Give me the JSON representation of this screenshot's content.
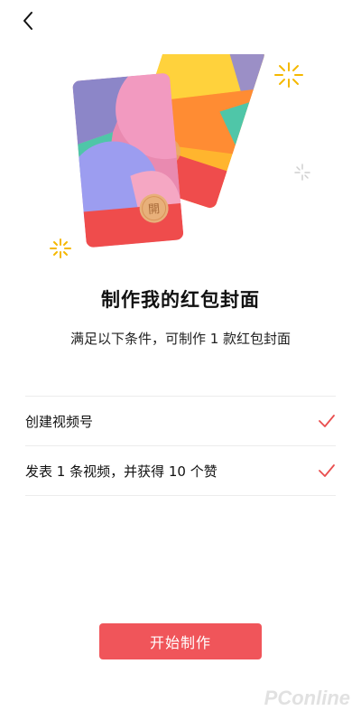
{
  "header": {
    "back_icon": "chevron-left-icon"
  },
  "hero": {
    "card_seal_char": "開",
    "colors": {
      "card_bottom": "#ef4c4c",
      "pink": "#eb8fb4",
      "purple": "#8c86c8",
      "teal": "#4fc6a8",
      "yellow": "#ffcf33",
      "orange": "#ff8a33",
      "sparkle": "#f5b800"
    }
  },
  "title": "制作我的红包封面",
  "subtitle": "满足以下条件，可制作 1 款红包封面",
  "requirements": [
    {
      "label": "创建视频号",
      "status": "done",
      "icon": "checkmark-icon"
    },
    {
      "label": "发表 1 条视频，并获得 10 个赞",
      "status": "done",
      "icon": "checkmark-icon"
    }
  ],
  "start_button": {
    "label": "开始制作",
    "color": "#f0555a"
  },
  "watermark": "PConline",
  "colors": {
    "accent": "#f0555a",
    "check": "#e94e4e",
    "divider": "#ececec"
  }
}
